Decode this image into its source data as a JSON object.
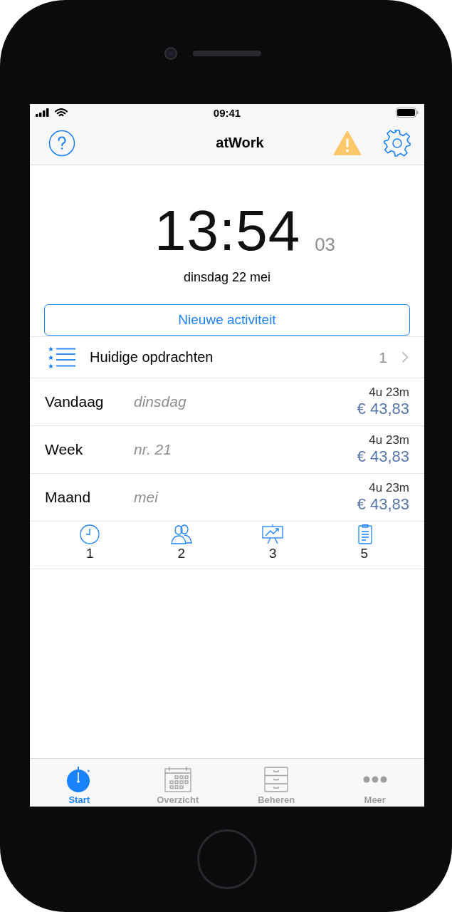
{
  "status_bar": {
    "time": "09:41"
  },
  "nav": {
    "title": "atWork"
  },
  "clock": {
    "time": "13:54",
    "seconds": "03",
    "date": "dinsdag 22 mei"
  },
  "new_activity_button": "Nieuwe activiteit",
  "assignments": {
    "label": "Huidige opdrachten",
    "count": "1"
  },
  "periods": [
    {
      "label": "Vandaag",
      "detail": "dinsdag",
      "duration": "4u 23m",
      "amount": "€ 43,83"
    },
    {
      "label": "Week",
      "detail": "nr. 21",
      "duration": "4u 23m",
      "amount": "€ 43,83"
    },
    {
      "label": "Maand",
      "detail": "mei",
      "duration": "4u 23m",
      "amount": "€ 43,83"
    }
  ],
  "counters": [
    {
      "kind": "clock",
      "count": "1"
    },
    {
      "kind": "people",
      "count": "2"
    },
    {
      "kind": "presentation",
      "count": "3"
    },
    {
      "kind": "clipboard",
      "count": "5"
    }
  ],
  "tab_bar": [
    {
      "kind": "stopwatch",
      "label": "Start",
      "selected": true
    },
    {
      "kind": "calendar",
      "label": "Overzicht",
      "selected": false
    },
    {
      "kind": "cabinet",
      "label": "Beheren",
      "selected": false
    },
    {
      "kind": "more",
      "label": "Meer",
      "selected": false
    }
  ]
}
